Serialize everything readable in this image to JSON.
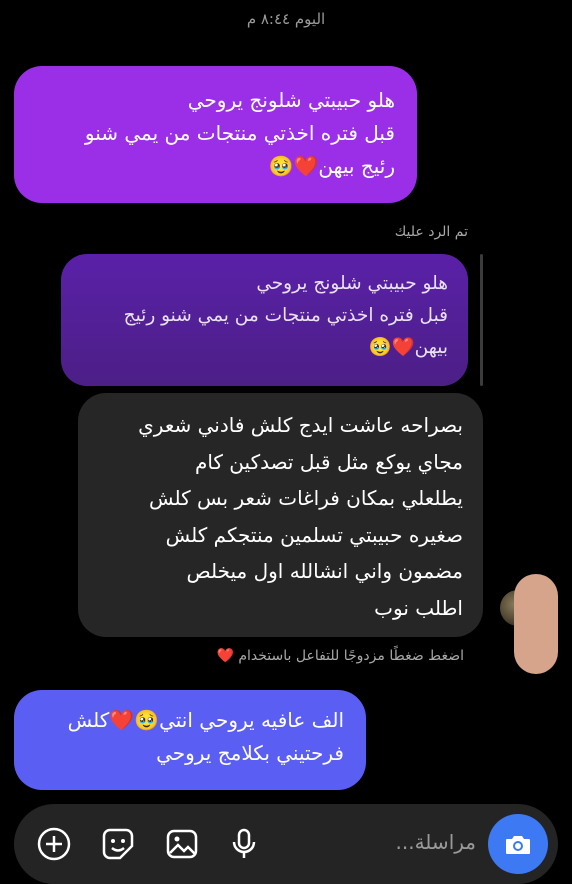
{
  "timestamp": "اليوم ٨:٤٤ م",
  "messages": [
    {
      "id": "m1",
      "sender": "me",
      "text": "هلو حبيبتي شلونج يروحي\nقبل فتره اخذتي منتجات من يمي شنو\nرئيج بيهن❤️🥹"
    },
    {
      "id": "m2",
      "sender": "quoted",
      "text": "هلو حبيبتي شلونج يروحي\nقبل فتره اخذتي منتجات من يمي شنو رئيج\nبيهن❤️🥹"
    },
    {
      "id": "m3",
      "sender": "other",
      "text": "بصراحه عاشت ايدج كلش فادني شعري\nمجاي يوكع مثل قبل تصدكين كام\nيطلعلي بمكان فراغات شعر بس كلش\nصغيره حبيبتي تسلمين منتجكم كلش\nمضمون واني انشالله اول ميخلص\nاطلب نوب"
    },
    {
      "id": "m4",
      "sender": "me",
      "text": "الف عافيه يروحي انتي🥹❤️كلش\nفرحتيني بكلامج يروحي"
    }
  ],
  "reply_label": "تم الرد عليك",
  "double_tap_hint": "اضغط ضغطًا مزدوجًا للتفاعل باستخدام",
  "double_tap_emoji": "❤️",
  "composer": {
    "placeholder": "مراسلة..."
  },
  "colors": {
    "bubble_me": "#9b2fe8",
    "bubble_quoted": "#5a20a8",
    "bubble_other": "#262626",
    "bubble_me_blue": "#5b5ef2",
    "camera_button": "#3d79f2",
    "composer_bg": "#242424"
  },
  "icons": [
    "camera-icon",
    "microphone-icon",
    "image-icon",
    "sticker-icon",
    "plus-icon"
  ]
}
